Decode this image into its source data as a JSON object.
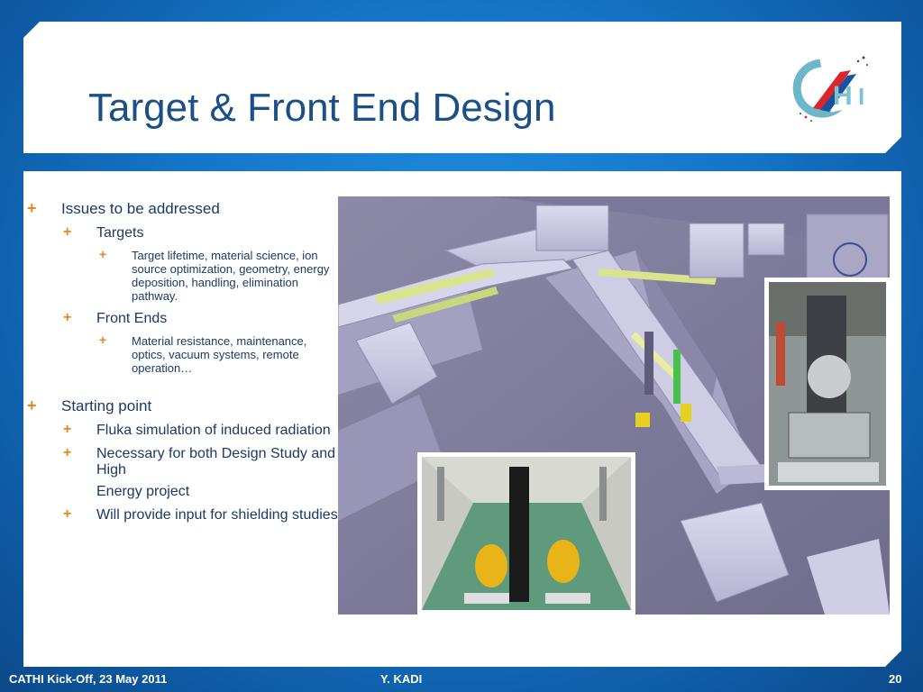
{
  "slide": {
    "title": "Target & Front End Design",
    "slide_number": "20"
  },
  "bullets": {
    "issues": "Issues to be addressed",
    "targets": "Targets",
    "targets_detail": "Target lifetime, material science, ion source optimization, geometry, energy deposition, handling, elimination pathway.",
    "front_ends": "Front Ends",
    "front_ends_detail": "Material resistance, maintenance, optics, vacuum systems, remote operation…",
    "starting_point": "Starting point",
    "fluka": "Fluka simulation of induced radiation",
    "necessary": "Necessary for both Design Study and High",
    "energy_project": "Energy project",
    "shielding": "Will provide input for shielding studies"
  },
  "footer": {
    "left": "CATHI Kick-Off, 23 May 2011",
    "center": "Y. KADI"
  },
  "images": {
    "facility_render": "facility-3d-render",
    "tunnel_photo": "beamline-tunnel-photo",
    "target_station_photo": "target-station-photo",
    "logo_text": "CATHI"
  },
  "colors": {
    "title": "#1b4f86",
    "bullet_mark": "#e8861c",
    "text": "#1c3a63",
    "background": "#1576c9"
  }
}
